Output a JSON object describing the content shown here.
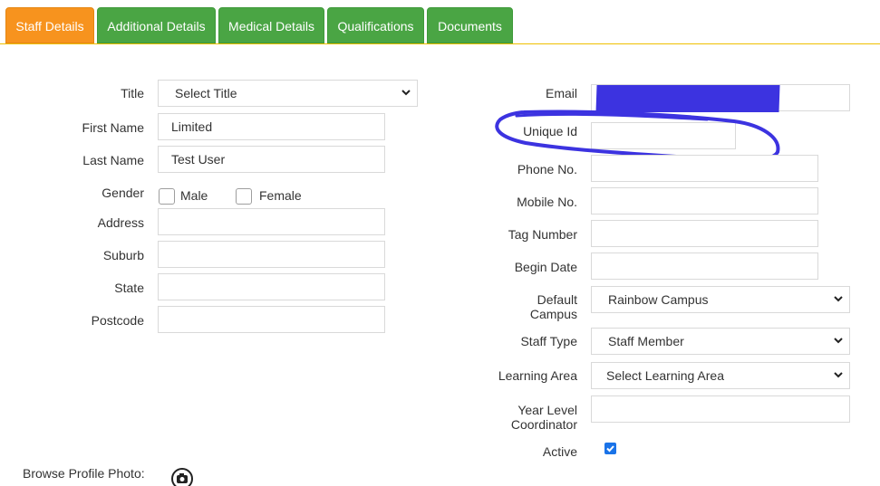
{
  "tabs": [
    {
      "label": "Staff Details",
      "active": true
    },
    {
      "label": "Additional Details",
      "active": false
    },
    {
      "label": "Medical Details",
      "active": false
    },
    {
      "label": "Qualifications",
      "active": false
    },
    {
      "label": "Documents",
      "active": false
    }
  ],
  "colors": {
    "tab_active": "#f7931e",
    "tab_inactive": "#4aa544",
    "accent_line": "#f0c000",
    "annotation": "#3c33e0"
  },
  "left": {
    "title_label": "Title",
    "title_value": "Select Title",
    "first_name_label": "First Name",
    "first_name_value": "Limited",
    "last_name_label": "Last Name",
    "last_name_value": "Test User",
    "gender_label": "Gender",
    "gender_male": "Male",
    "gender_female": "Female",
    "address_label": "Address",
    "address_value": "",
    "suburb_label": "Suburb",
    "suburb_value": "",
    "state_label": "State",
    "state_value": "",
    "postcode_label": "Postcode",
    "postcode_value": ""
  },
  "right": {
    "email_label": "Email",
    "unique_id_label": "Unique Id",
    "unique_id_value": "",
    "phone_label": "Phone No.",
    "phone_value": "",
    "mobile_label": "Mobile No.",
    "mobile_value": "",
    "tag_label": "Tag Number",
    "tag_value": "",
    "begin_date_label": "Begin Date",
    "begin_date_value": "",
    "default_campus_label_1": "Default",
    "default_campus_label_2": "Campus",
    "default_campus_value": "Rainbow Campus",
    "staff_type_label": "Staff Type",
    "staff_type_value": "Staff Member",
    "learning_area_label": "Learning Area",
    "learning_area_value": "Select Learning Area",
    "year_level_label_1": "Year Level",
    "year_level_label_2": "Coordinator",
    "year_level_value": "",
    "active_label": "Active",
    "active_checked": true
  },
  "photo": {
    "label": "Browse Profile Photo:",
    "icon": "camera-icon"
  }
}
